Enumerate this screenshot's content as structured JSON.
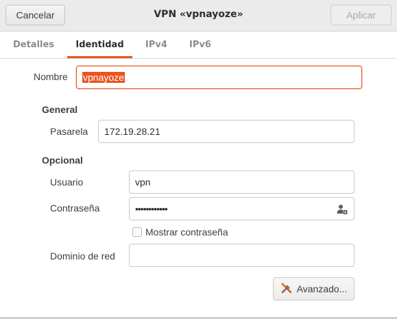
{
  "header": {
    "cancel_label": "Cancelar",
    "title": "VPN «vpnayoze»",
    "apply_label": "Aplicar"
  },
  "tabs": [
    {
      "label": "Detalles",
      "active": false
    },
    {
      "label": "Identidad",
      "active": true
    },
    {
      "label": "IPv4",
      "active": false
    },
    {
      "label": "IPv6",
      "active": false
    }
  ],
  "form": {
    "name_label": "Nombre",
    "name_value": "vpnayoze",
    "general_heading": "General",
    "gateway_label": "Pasarela",
    "gateway_value": "172.19.28.21",
    "optional_heading": "Opcional",
    "user_label": "Usuario",
    "user_value": "vpn",
    "password_label": "Contraseña",
    "password_value": "••••••••••••",
    "password_icon": "user-password-icon",
    "show_password_label": "Mostrar contraseña",
    "show_password_checked": false,
    "domain_label": "Dominio de red",
    "domain_value": "",
    "advanced_label": "Avanzado...",
    "advanced_icon": "tools-icon"
  },
  "colors": {
    "accent": "#e95420",
    "header_bg": "#ebebeb"
  }
}
